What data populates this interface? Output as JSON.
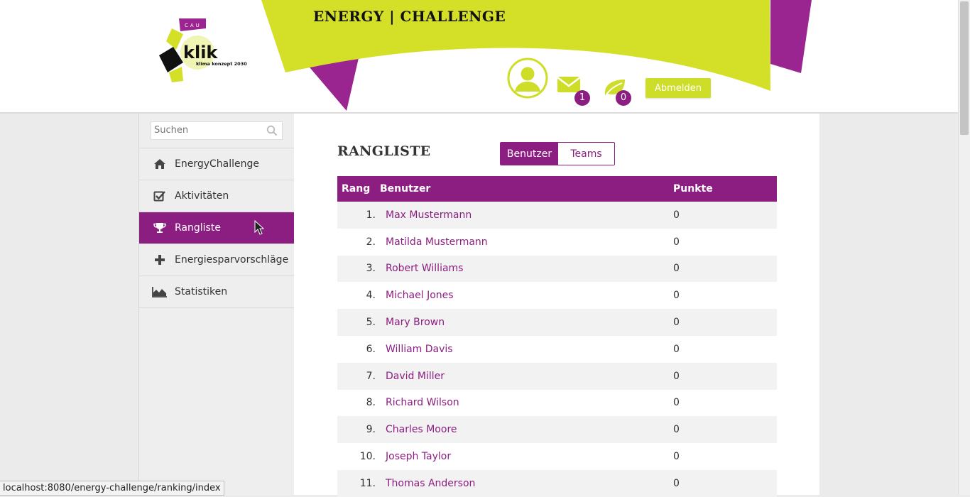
{
  "header": {
    "site_title": "ENERGY | CHALLENGE",
    "logo": {
      "word": "klik",
      "subtitle": "klima konzept 2030",
      "badge": "CAU"
    },
    "messages_count": "1",
    "points_count": "0",
    "logout_label": "Abmelden"
  },
  "colors": {
    "purple": "#8c1e82",
    "lime": "#cddd28"
  },
  "sidebar": {
    "search_placeholder": "Suchen",
    "items": [
      {
        "label": "EnergyChallenge",
        "icon": "home-icon"
      },
      {
        "label": "Aktivitäten",
        "icon": "checkbox-icon"
      },
      {
        "label": "Rangliste",
        "icon": "trophy-icon",
        "active": true
      },
      {
        "label": "Energiesparvorschläge",
        "icon": "plus-icon"
      },
      {
        "label": "Statistiken",
        "icon": "area-chart-icon"
      }
    ]
  },
  "main": {
    "heading": "RANGLISTE",
    "toggle": {
      "users": "Benutzer",
      "teams": "Teams",
      "selected": "Benutzer"
    },
    "table": {
      "headers": {
        "rank": "Rang",
        "user": "Benutzer",
        "points": "Punkte"
      },
      "rows": [
        {
          "rank": "1.",
          "name": "Max Mustermann",
          "points": "0"
        },
        {
          "rank": "2.",
          "name": "Matilda Mustermann",
          "points": "0"
        },
        {
          "rank": "3.",
          "name": "Robert Williams",
          "points": "0"
        },
        {
          "rank": "4.",
          "name": "Michael Jones",
          "points": "0"
        },
        {
          "rank": "5.",
          "name": "Mary Brown",
          "points": "0"
        },
        {
          "rank": "6.",
          "name": "William Davis",
          "points": "0"
        },
        {
          "rank": "7.",
          "name": "David Miller",
          "points": "0"
        },
        {
          "rank": "8.",
          "name": "Richard Wilson",
          "points": "0"
        },
        {
          "rank": "9.",
          "name": "Charles Moore",
          "points": "0"
        },
        {
          "rank": "10.",
          "name": "Joseph Taylor",
          "points": "0"
        },
        {
          "rank": "11.",
          "name": "Thomas Anderson",
          "points": "0"
        }
      ]
    }
  },
  "statusbar": {
    "url": "localhost:8080/energy-challenge/ranking/index"
  }
}
